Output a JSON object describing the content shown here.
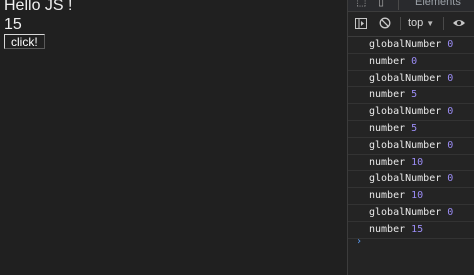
{
  "page": {
    "heading": "Hello JS !",
    "counter_value": "15",
    "button_label": "click!"
  },
  "devtools": {
    "tabs": [
      {
        "icon": "inspect-element-icon"
      },
      {
        "icon": "device-toolbar-icon"
      },
      {
        "label": "Elements"
      }
    ],
    "toolbar": {
      "icons": [
        "sidebar-toggle-icon",
        "clear-console-icon",
        "eye-icon"
      ],
      "context_label": "top"
    },
    "console_logs": [
      {
        "label": "globalNumber",
        "value": "0"
      },
      {
        "label": "number",
        "value": "0"
      },
      {
        "label": "globalNumber",
        "value": "0"
      },
      {
        "label": "number",
        "value": "5"
      },
      {
        "label": "globalNumber",
        "value": "0"
      },
      {
        "label": "number",
        "value": "5"
      },
      {
        "label": "globalNumber",
        "value": "0"
      },
      {
        "label": "number",
        "value": "10"
      },
      {
        "label": "globalNumber",
        "value": "0"
      },
      {
        "label": "number",
        "value": "10"
      },
      {
        "label": "globalNumber",
        "value": "0"
      },
      {
        "label": "number",
        "value": "15"
      }
    ],
    "prompt_symbol": "›",
    "colors": {
      "number_value": "#9b8cf5",
      "prompt": "#5c9cf5"
    }
  }
}
